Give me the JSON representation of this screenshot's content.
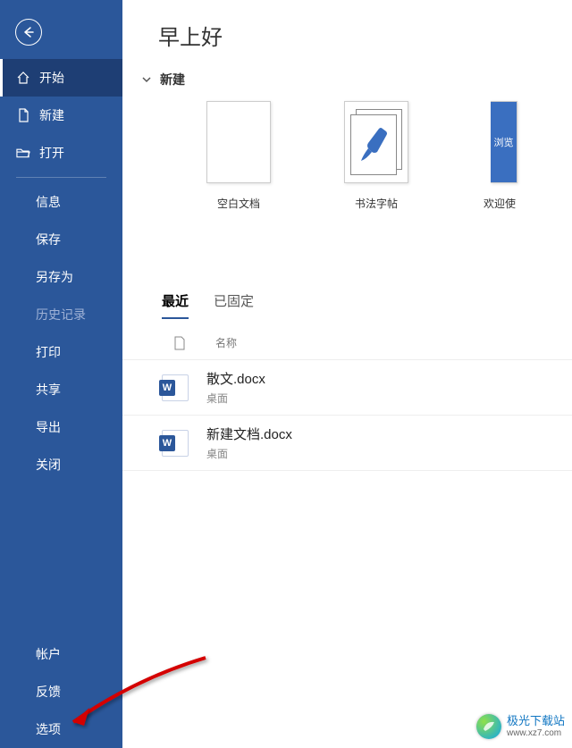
{
  "sidebar": {
    "start": "开始",
    "new": "新建",
    "open": "打开",
    "info": "信息",
    "save": "保存",
    "saveAs": "另存为",
    "history": "历史记录",
    "print": "打印",
    "share": "共享",
    "export": "导出",
    "close": "关闭",
    "account": "帐户",
    "feedback": "反馈",
    "options": "选项"
  },
  "main": {
    "greeting": "早上好",
    "newSection": "新建",
    "templates": {
      "blank": "空白文档",
      "calligraphy": "书法字帖",
      "welcome": "欢迎使",
      "welcomeTour": "浏览"
    },
    "tabs": {
      "recent": "最近",
      "pinned": "已固定"
    },
    "listHeader": {
      "name": "名称"
    },
    "files": [
      {
        "name": "散文.docx",
        "location": "桌面"
      },
      {
        "name": "新建文档.docx",
        "location": "桌面"
      }
    ]
  },
  "watermark": {
    "title": "极光下载站",
    "url": "www.xz7.com"
  }
}
